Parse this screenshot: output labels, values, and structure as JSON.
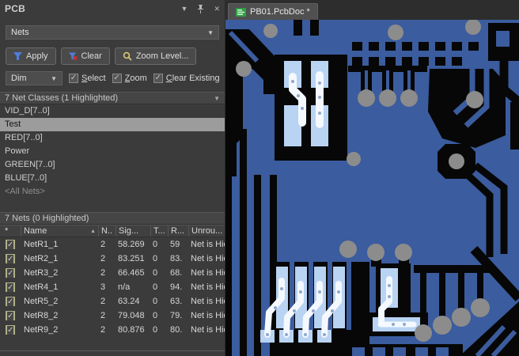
{
  "panel": {
    "title": "PCB",
    "mode_select": {
      "value": "Nets"
    },
    "toolbar": {
      "apply": "Apply",
      "clear": "Clear",
      "zoom_level": "Zoom Level..."
    },
    "dim_row": {
      "value": "Dim",
      "checkboxes": [
        {
          "label": "Select",
          "checked": true
        },
        {
          "label": "Zoom",
          "checked": true
        },
        {
          "label": "Clear Existing",
          "checked": true
        }
      ]
    },
    "net_classes": {
      "header": "7 Net Classes (1 Highlighted)",
      "items": [
        {
          "label": "VID_D[7..0]"
        },
        {
          "label": "Test",
          "state": "selected"
        },
        {
          "label": "RED[7..0]"
        },
        {
          "label": "Power"
        },
        {
          "label": "GREEN[7..0]"
        },
        {
          "label": "BLUE[7..0]"
        },
        {
          "label": "<All Nets>",
          "state": "muted"
        }
      ]
    },
    "nets": {
      "header": "7 Nets (0 Highlighted)",
      "columns": [
        "*",
        "Name",
        "N..",
        "Sig...",
        "T...",
        "R...",
        "Unrou..."
      ],
      "rows": [
        {
          "checked": true,
          "name": "NetR1_1",
          "n": "2",
          "sig": "58.269",
          "t": "0",
          "r": "59",
          "unrou": "Net is Hid"
        },
        {
          "checked": true,
          "name": "NetR2_1",
          "n": "2",
          "sig": "83.251",
          "t": "0",
          "r": "83.",
          "unrou": "Net is Hid"
        },
        {
          "checked": true,
          "name": "NetR3_2",
          "n": "2",
          "sig": "66.465",
          "t": "0",
          "r": "68.",
          "unrou": "Net is Hid"
        },
        {
          "checked": true,
          "name": "NetR4_1",
          "n": "3",
          "sig": "n/a",
          "t": "0",
          "r": "94.",
          "unrou": "Net is Hid"
        },
        {
          "checked": true,
          "name": "NetR5_2",
          "n": "2",
          "sig": "63.24",
          "t": "0",
          "r": "63.",
          "unrou": "Net is Hid"
        },
        {
          "checked": true,
          "name": "NetR8_2",
          "n": "2",
          "sig": "79.048",
          "t": "0",
          "r": "79.",
          "unrou": "Net is Hid"
        },
        {
          "checked": true,
          "name": "NetR9_2",
          "n": "2",
          "sig": "80.876",
          "t": "0",
          "r": "80.",
          "unrou": "Net is Hid"
        }
      ]
    }
  },
  "document": {
    "tab_label": "PB01.PcbDoc *"
  },
  "icons": {
    "dropdown": "▼",
    "close": "✕",
    "check": "✓",
    "sort_asc": "▲"
  },
  "colors": {
    "panel-bg": "#3B3B3B",
    "panel-text": "#D4D4D4",
    "control-bg": "#4D4D4D",
    "control-border": "#6A6A6A",
    "header-bg": "#454545",
    "selected-bg": "#9C9C9C",
    "selected-text": "#141414",
    "muted-text": "#8F8F8F",
    "tabbar-bg": "#2D2D2D",
    "tab-bg": "#505050",
    "tab-text": "#E8E8E8",
    "tab-icon-green": "#2F9E44",
    "checkbox-frame": "#B0B088",
    "pcb-blue": "#3B5C9E",
    "pcb-black": "#070707",
    "pcb-via": "#8C8C8C",
    "pcb-highlight": "#B9D3F2",
    "pcb-highlight-bright": "#F4F8FF",
    "apply-funnel": "#4D7EDB",
    "clear-x": "#D03030",
    "magnifier": "#D8C878"
  }
}
